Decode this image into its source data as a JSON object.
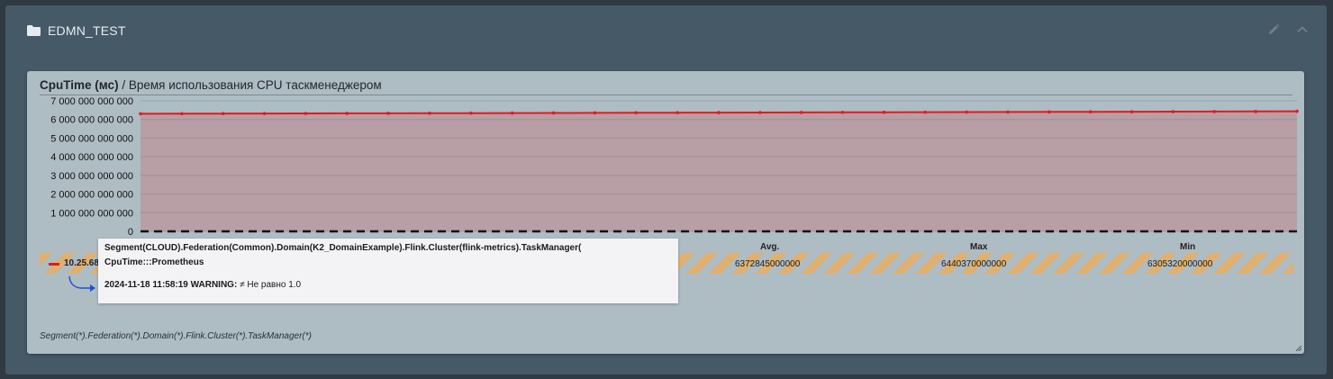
{
  "dashboard": {
    "title": "EDMN_TEST",
    "icons": {
      "folder": "folder-icon",
      "edit": "pencil-icon",
      "collapse": "chevron-up-icon"
    }
  },
  "panel": {
    "title_bold": "CpuTime (мс)",
    "title_rest": " / Время использования CPU таскменеджером",
    "footer_path": "Segment(*).Federation(*).Domain(*).Flink.Cluster(*).TaskManager(*)"
  },
  "table": {
    "headers": {
      "avg": "Avg.",
      "max": "Max",
      "min": "Min"
    },
    "row": {
      "name": "10.25.68",
      "avg": "6372845000000",
      "max": "6440370000000",
      "min": "6305320000000"
    }
  },
  "tooltip": {
    "line1": "Segment(CLOUD).Federation(Common).Domain(K2_DomainExample).Flink.Cluster(flink-metrics).TaskManager(",
    "line2": "CpuTime:::Prometheus",
    "line3_bold": "2024-11-18 11:58:19 WARNING:",
    "line3_rest": " ≠ Не равно 1.0"
  },
  "colors": {
    "series": "#e31a1c",
    "area": "rgba(227,26,28,0.18)",
    "hazard": "#dfb06f",
    "panel_bg": "#aebcc4"
  },
  "chart_data": {
    "type": "area",
    "ylim": [
      0,
      7000000000000
    ],
    "y_ticks": [
      "7 000 000 000 000",
      "6 000 000 000 000",
      "5 000 000 000 000",
      "4 000 000 000 000",
      "3 000 000 000 000",
      "2 000 000 000 000",
      "1 000 000 000 000",
      "0"
    ],
    "y_tick_values": [
      7000000000000,
      6000000000000,
      5000000000000,
      4000000000000,
      3000000000000,
      2000000000000,
      1000000000000,
      0
    ],
    "threshold": 0,
    "series": [
      {
        "values": [
          6305320000000,
          6309000000000,
          6313000000000,
          6318000000000,
          6322000000000,
          6327000000000,
          6331000000000,
          6336000000000,
          6341000000000,
          6345000000000,
          6350000000000,
          6355000000000,
          6359000000000,
          6364000000000,
          6368000000000,
          6373000000000,
          6378000000000,
          6382000000000,
          6387000000000,
          6391000000000,
          6396000000000,
          6401000000000,
          6405000000000,
          6410000000000,
          6414000000000,
          6419000000000,
          6424000000000,
          6428000000000,
          6440370000000
        ]
      }
    ]
  }
}
